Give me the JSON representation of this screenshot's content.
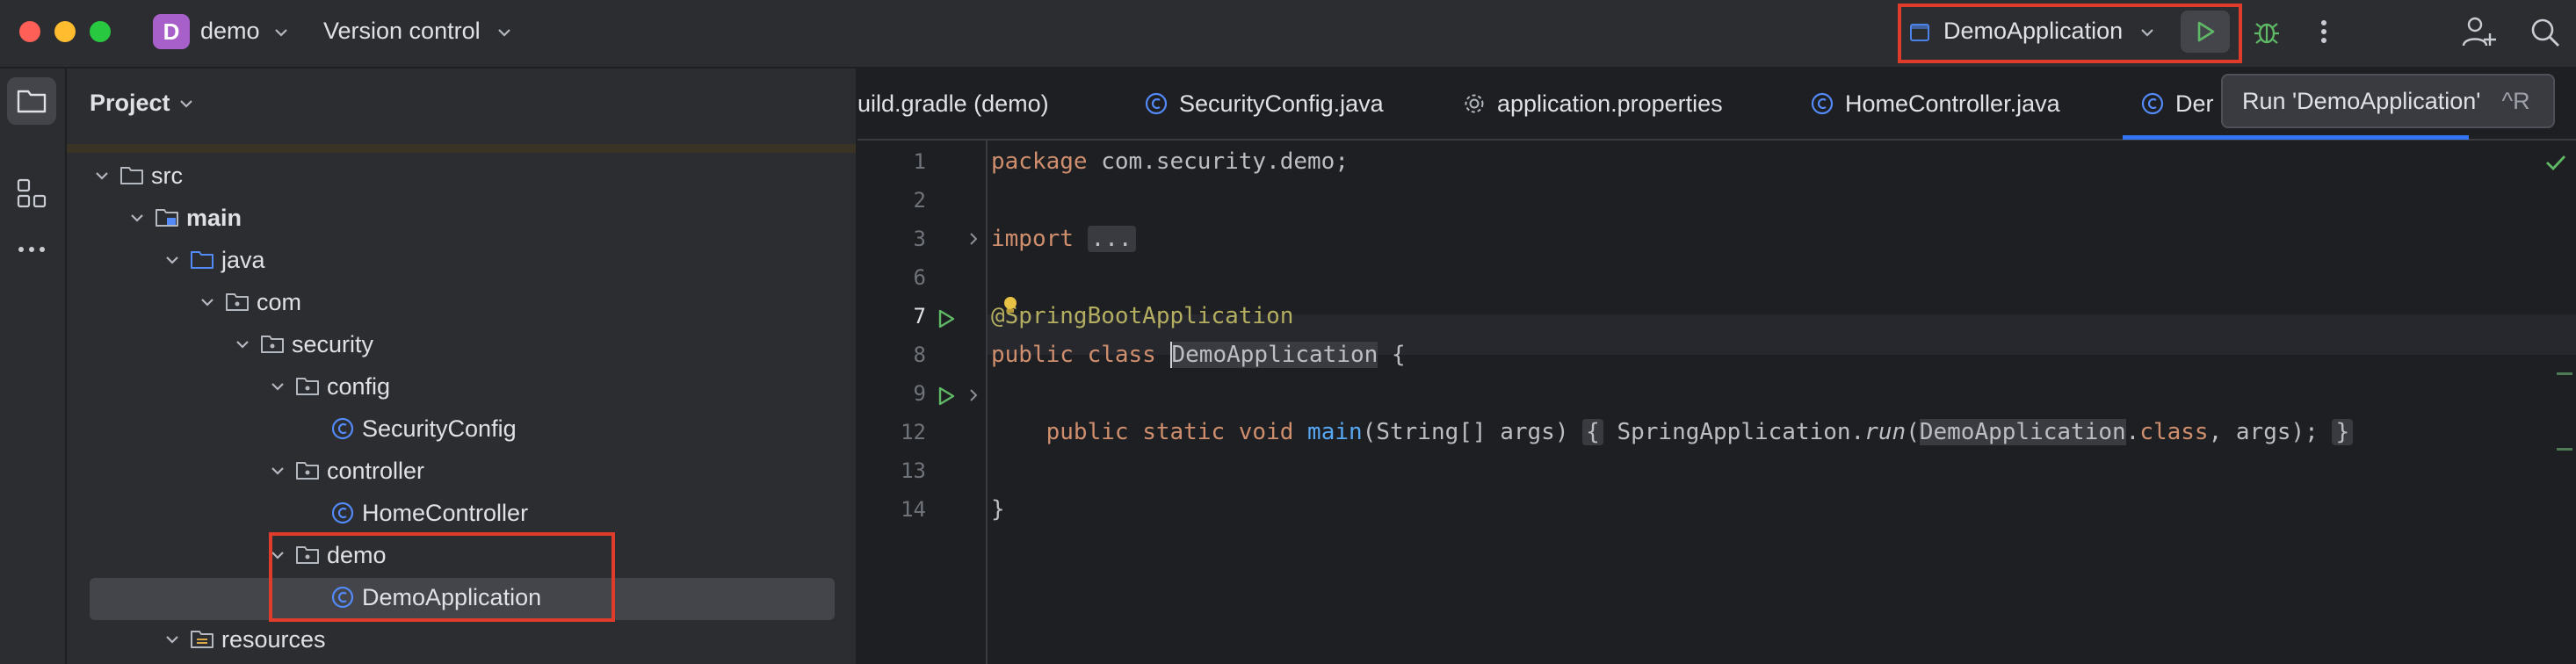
{
  "titlebar": {
    "project_badge": "D",
    "project_name": "demo",
    "version_control": "Version control",
    "run_config": "DemoApplication"
  },
  "tooltip": {
    "text": "Run 'DemoApplication'",
    "shortcut": "^R"
  },
  "project_panel": {
    "title": "Project",
    "tree": [
      {
        "label": "src",
        "type": "folder",
        "depth": 0,
        "bold": false
      },
      {
        "label": "main",
        "type": "module-folder",
        "depth": 1,
        "bold": true
      },
      {
        "label": "java",
        "type": "source-folder",
        "depth": 2,
        "bold": false
      },
      {
        "label": "com",
        "type": "package",
        "depth": 3,
        "bold": false
      },
      {
        "label": "security",
        "type": "package",
        "depth": 4,
        "bold": false
      },
      {
        "label": "config",
        "type": "package",
        "depth": 5,
        "bold": false
      },
      {
        "label": "SecurityConfig",
        "type": "class",
        "depth": 6,
        "bold": false
      },
      {
        "label": "controller",
        "type": "package",
        "depth": 5,
        "bold": false
      },
      {
        "label": "HomeController",
        "type": "class",
        "depth": 6,
        "bold": false
      },
      {
        "label": "demo",
        "type": "package",
        "depth": 5,
        "bold": false
      },
      {
        "label": "DemoApplication",
        "type": "class",
        "depth": 6,
        "bold": false,
        "selected": true
      },
      {
        "label": "resources",
        "type": "resources-folder",
        "depth": 2,
        "bold": false
      }
    ]
  },
  "editor": {
    "tabs": [
      {
        "label": "uild.gradle (demo)",
        "icon": "gradle-icon"
      },
      {
        "label": "SecurityConfig.java",
        "icon": "class-icon"
      },
      {
        "label": "application.properties",
        "icon": "gear-icon"
      },
      {
        "label": "HomeController.java",
        "icon": "class-icon"
      },
      {
        "label": "Der",
        "icon": "class-icon",
        "active": true
      }
    ],
    "line_numbers": [
      "1",
      "2",
      "3",
      "6",
      "7",
      "8",
      "9",
      "12",
      "13",
      "14"
    ],
    "code": {
      "l1_kw": "package",
      "l1_rest": " com.security.demo;",
      "l3_kw": "import",
      "l3_fold": "...",
      "l6_ann": "@SpringBootApplication",
      "l7_kw": "public class ",
      "l7_cls": "DemoApplication",
      "l7_rest": " {",
      "l9_kw": "public static void ",
      "l9_fn": "main",
      "l9_params": "(String[] args)",
      "l9_open": "{",
      "l9_cls1": " SpringApplication.",
      "l9_run": "run",
      "l9_paren": "(",
      "l9_cls2": "DemoApplication",
      "l9_dot": ".",
      "l9_kwclass": "class",
      "l9_end": ", args);",
      "l9_close": "}",
      "l13": "}"
    }
  },
  "colors": {
    "accent": "#3574f0",
    "highlight_border": "#e03c2c",
    "run_green": "#5fb865"
  }
}
